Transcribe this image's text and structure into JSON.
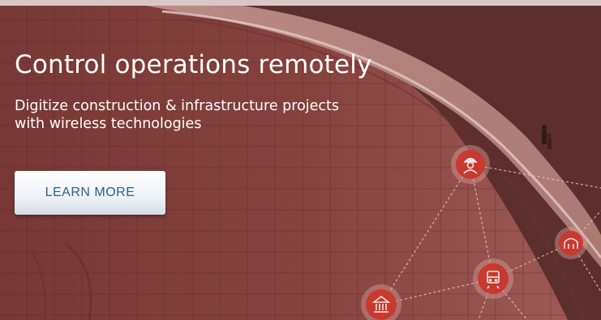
{
  "hero": {
    "headline": "Control operations remotely",
    "subtitle_line1": "Digitize construction & infrastructure projects",
    "subtitle_line2": "with wireless technologies",
    "cta_label": "LEARN MORE"
  },
  "icons": [
    "worker-icon",
    "tunnel-icon",
    "train-icon",
    "bank-icon"
  ],
  "colors": {
    "overlay": "#6a2e2c",
    "node_red": "#d63b30",
    "cta_text": "#2c5f93"
  }
}
